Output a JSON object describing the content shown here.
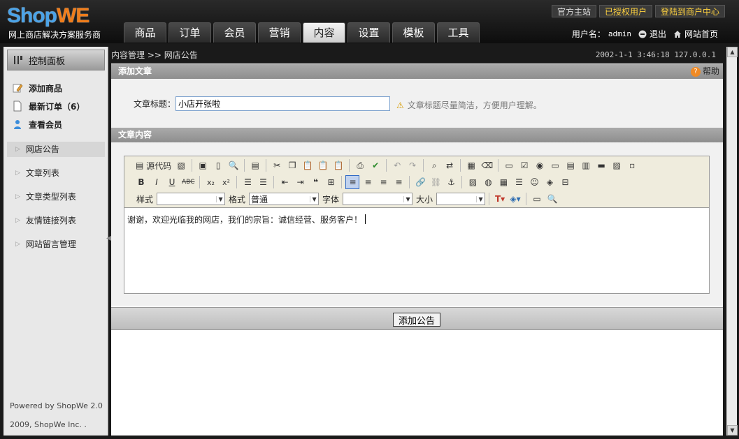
{
  "header": {
    "logo_a": "Shop",
    "logo_b": "WE",
    "tagline": "网上商店解决方案服务商",
    "top_links": [
      "官方主站",
      "已授权用户",
      "登陆到商户中心"
    ],
    "nav": [
      "商品",
      "订单",
      "会员",
      "营销",
      "内容",
      "设置",
      "模板",
      "工具"
    ],
    "active_nav": "内容",
    "user_label": "用户名：",
    "username": "admin",
    "logout": "退出",
    "home": "网站首页"
  },
  "sidebar": {
    "panel_title": "控制面板",
    "quick": [
      "添加商品",
      "最新订单（6）",
      "查看会员"
    ],
    "menu": [
      "网店公告",
      "文章列表",
      "文章类型列表",
      "友情链接列表",
      "网站留言管理"
    ],
    "powered": "Powered by ShopWe 2.0",
    "copyright": "2009, ShopWe Inc. ."
  },
  "main": {
    "breadcrumb": "内容管理 >> 网店公告",
    "timestamp": "2002-1-1 3:46:18 127.0.0.1",
    "section_add": "添加文章",
    "help": "帮助",
    "title_label": "文章标题：",
    "title_value": "小店开张啦",
    "title_tip": "文章标题尽量简洁，方便用户理解。",
    "section_content": "文章内容",
    "editor": {
      "source": "源代码",
      "style_label": "样式",
      "format_label": "格式",
      "format_value": "普通",
      "font_label": "字体",
      "size_label": "大小",
      "body_text": "谢谢，欢迎光临我的网店，我们的宗旨：诚信经营、服务客户！"
    },
    "submit": "添加公告"
  }
}
